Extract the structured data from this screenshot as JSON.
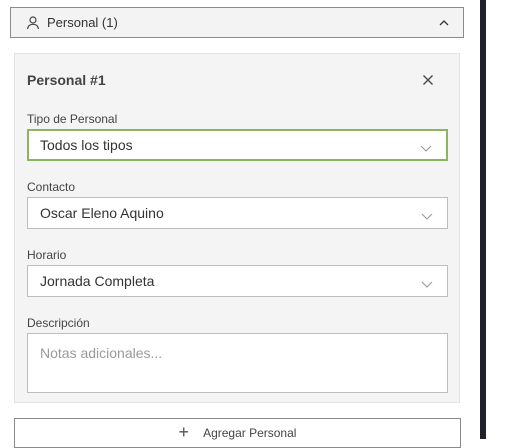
{
  "section": {
    "title": "Personal (1)",
    "icon": "user-icon"
  },
  "card": {
    "title": "Personal #1",
    "fields": {
      "tipo": {
        "label": "Tipo de Personal",
        "value": "Todos los tipos"
      },
      "contacto": {
        "label": "Contacto",
        "value": "Oscar Eleno Aquino"
      },
      "horario": {
        "label": "Horario",
        "value": "Jornada Completa"
      },
      "descripcion": {
        "label": "Descripción",
        "placeholder": "Notas adicionales..."
      }
    }
  },
  "add_button": {
    "label": "Agregar Personal",
    "icon": "+"
  },
  "colors": {
    "focus_border": "#8bb560",
    "border": "#bdbdbd",
    "card_bg": "#f4f4f4"
  }
}
